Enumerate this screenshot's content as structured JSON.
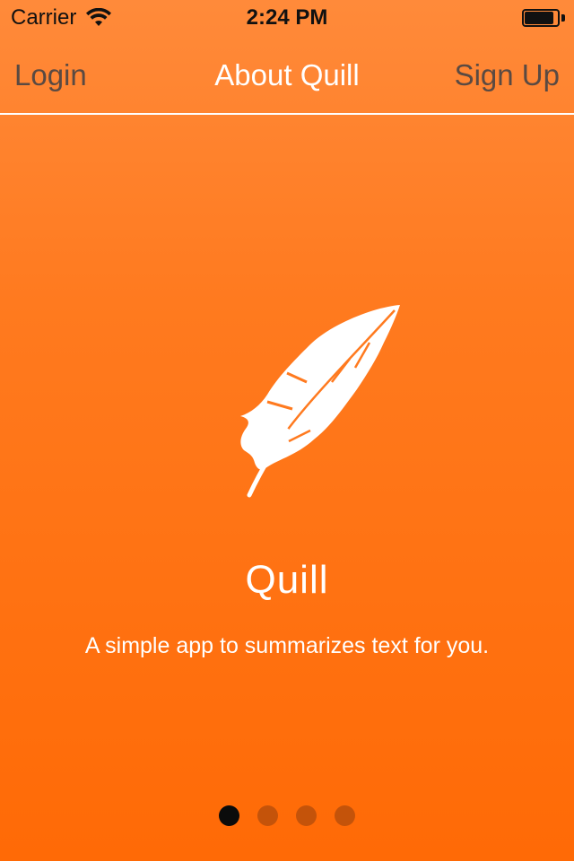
{
  "status_bar": {
    "carrier": "Carrier",
    "time": "2:24 PM",
    "battery_level": 0.95
  },
  "nav": {
    "left_label": "Login",
    "title": "About Quill",
    "right_label": "Sign Up"
  },
  "hero": {
    "icon": "feather-icon",
    "app_name": "Quill",
    "tagline": "A simple app to summarizes text for you."
  },
  "pager": {
    "page_count": 4,
    "current_page": 1
  },
  "colors": {
    "background_top": "#ff8a3a",
    "background_bottom": "#ff6a06",
    "nav_button_text": "#5a4a42",
    "dot_active": "#0b0b0b",
    "dot_inactive": "#c4530a"
  }
}
